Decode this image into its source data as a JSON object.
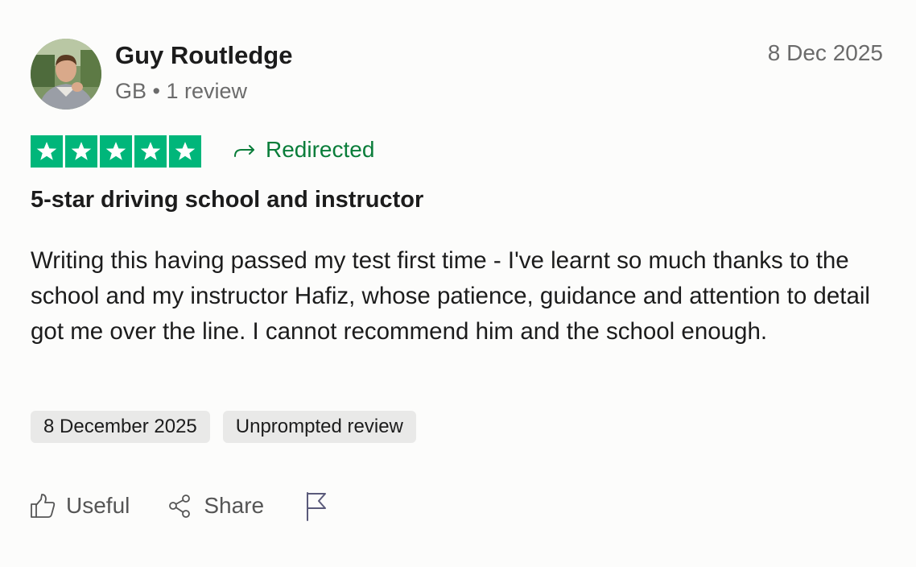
{
  "reviewer": {
    "name": "Guy Routledge",
    "country": "GB",
    "separator": "•",
    "review_count": "1 review",
    "avatar_icon": "avatar-photo"
  },
  "review": {
    "date": "8 Dec 2025",
    "rating": 5,
    "rating_max": 5,
    "star_color": "#00b67a",
    "redirected_label": "Redirected",
    "redirected_color": "#0a7d3a",
    "redirected_icon": "redirect-arrow-icon",
    "title": "5-star driving school and instructor",
    "body": "Writing this having passed my test first time - I've learnt so much thanks to the school and my instructor Hafiz, whose patience, guidance and attention to detail got me over the line. I cannot recommend him and the school enough.",
    "tags": [
      "8 December 2025",
      "Unprompted review"
    ]
  },
  "actions": {
    "useful_label": "Useful",
    "useful_icon": "thumbs-up-icon",
    "share_label": "Share",
    "share_icon": "share-icon",
    "flag_icon": "flag-icon"
  }
}
